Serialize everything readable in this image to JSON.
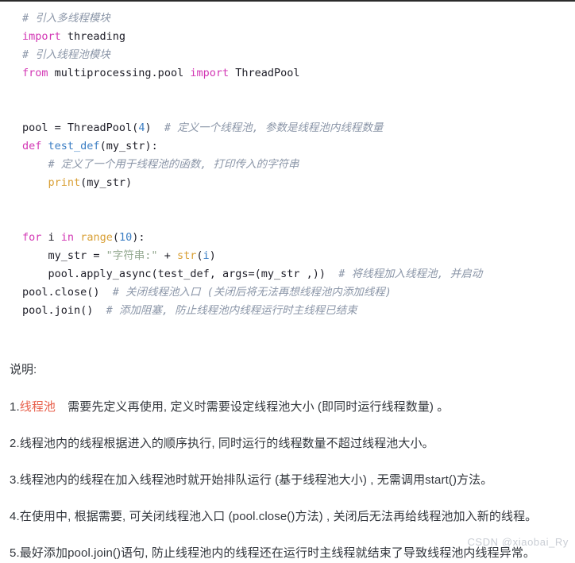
{
  "code_block": {
    "language": "python",
    "lines": [
      [
        {
          "t": "# 引入多线程模块",
          "c": "cmt"
        }
      ],
      [
        {
          "t": "import",
          "c": "kw"
        },
        {
          "t": " threading",
          "c": "plain"
        }
      ],
      [
        {
          "t": "# 引入线程池模块",
          "c": "cmt"
        }
      ],
      [
        {
          "t": "from",
          "c": "kw"
        },
        {
          "t": " multiprocessing.pool ",
          "c": "plain"
        },
        {
          "t": "import",
          "c": "kw"
        },
        {
          "t": " ThreadPool",
          "c": "plain"
        }
      ],
      [],
      [],
      [
        {
          "t": "pool = ThreadPool(",
          "c": "plain"
        },
        {
          "t": "4",
          "c": "num"
        },
        {
          "t": ")  ",
          "c": "plain"
        },
        {
          "t": "# 定义一个线程池, 参数是线程池内线程数量",
          "c": "cmt"
        }
      ],
      [
        {
          "t": "def",
          "c": "kw"
        },
        {
          "t": " ",
          "c": "plain"
        },
        {
          "t": "test_def",
          "c": "fn"
        },
        {
          "t": "(my_str):",
          "c": "plain"
        }
      ],
      [
        {
          "t": "    ",
          "c": "plain"
        },
        {
          "t": "# 定义了一个用于线程池的函数, 打印传入的字符串",
          "c": "cmt"
        }
      ],
      [
        {
          "t": "    ",
          "c": "plain"
        },
        {
          "t": "print",
          "c": "bif"
        },
        {
          "t": "(my_str)",
          "c": "plain"
        }
      ],
      [],
      [],
      [
        {
          "t": "for",
          "c": "kw"
        },
        {
          "t": " i ",
          "c": "plain"
        },
        {
          "t": "in",
          "c": "kw"
        },
        {
          "t": " ",
          "c": "plain"
        },
        {
          "t": "range",
          "c": "bif"
        },
        {
          "t": "(",
          "c": "plain"
        },
        {
          "t": "10",
          "c": "num"
        },
        {
          "t": "):",
          "c": "plain"
        }
      ],
      [
        {
          "t": "    my_str = ",
          "c": "plain"
        },
        {
          "t": "\"字符串:\"",
          "c": "str"
        },
        {
          "t": " + ",
          "c": "plain"
        },
        {
          "t": "str",
          "c": "bif"
        },
        {
          "t": "(",
          "c": "plain"
        },
        {
          "t": "i",
          "c": "var"
        },
        {
          "t": ")",
          "c": "plain"
        }
      ],
      [
        {
          "t": "    pool.apply_async(test_def, args=(my_str ,))  ",
          "c": "plain"
        },
        {
          "t": "# 将线程加入线程池, 并启动",
          "c": "cmt"
        }
      ],
      [
        {
          "t": "pool.close()  ",
          "c": "plain"
        },
        {
          "t": "# 关闭线程池入口 (关闭后将无法再想线程池内添加线程)",
          "c": "cmt"
        }
      ],
      [
        {
          "t": "pool.join()  ",
          "c": "plain"
        },
        {
          "t": "# 添加阻塞, 防止线程池内线程运行时主线程已结束",
          "c": "cmt"
        }
      ]
    ]
  },
  "explanation": {
    "title": "说明:",
    "items": [
      {
        "number": "1.",
        "highlight": "线程池",
        "rest": "　需要先定义再使用, 定义时需要设定线程池大小 (即同时运行线程数量) 。"
      },
      {
        "number": "2.",
        "highlight": "",
        "rest": "线程池内的线程根据进入的顺序执行, 同时运行的线程数量不超过线程池大小。"
      },
      {
        "number": "3.",
        "highlight": "",
        "rest": "线程池内的线程在加入线程池时就开始排队运行 (基于线程池大小) , 无需调用start()方法。"
      },
      {
        "number": "4.",
        "highlight": "",
        "rest": "在使用中, 根据需要, 可关闭线程池入口 (pool.close()方法) , 关闭后无法再给线程池加入新的线程。"
      },
      {
        "number": "5.",
        "highlight": "",
        "rest": "最好添加pool.join()语句, 防止线程池内的线程还在运行时主线程就结束了导致线程池内线程异常。"
      }
    ]
  },
  "watermark": {
    "text": "CSDN @xiaobai_Ry"
  },
  "colors": {
    "keyword": "#d236b4",
    "function": "#3b7ec4",
    "builtin": "#d9a036",
    "number": "#3b7ec4",
    "string": "#93a88f",
    "comment": "#8b96a8",
    "plain_text": "#20202a",
    "highlight_red": "#e8604c",
    "body_text": "#33373d",
    "watermark": "#c9cdd4",
    "background": "#ffffff"
  }
}
